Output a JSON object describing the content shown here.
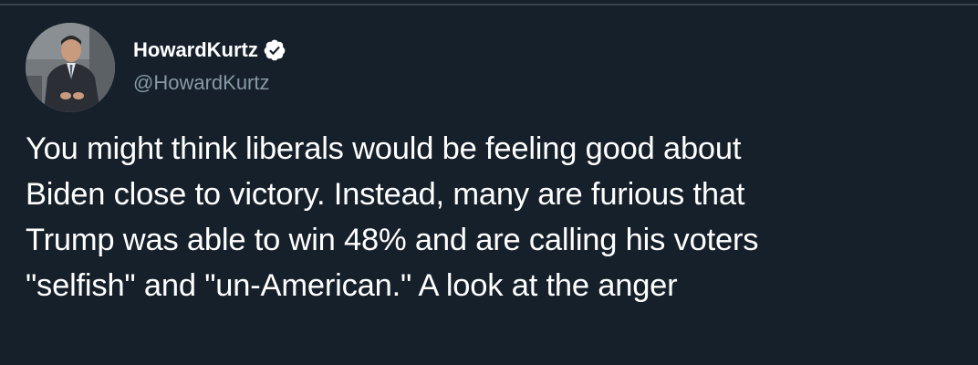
{
  "tweet": {
    "author": {
      "display_name": "HowardKurtz",
      "handle": "@HowardKurtz",
      "verified": true,
      "avatar_icon": "profile-photo"
    },
    "text_lines": [
      "You might think liberals would be feeling good about",
      "Biden close to victory. Instead, many are furious that",
      "Trump was able to win 48% and are calling his voters",
      "\"selfish\" and \"un-American.\" A look at the anger"
    ]
  },
  "colors": {
    "background": "#15202b",
    "text_primary": "#ffffff",
    "text_secondary": "#8899a6",
    "verified_badge": "#ffffff"
  }
}
